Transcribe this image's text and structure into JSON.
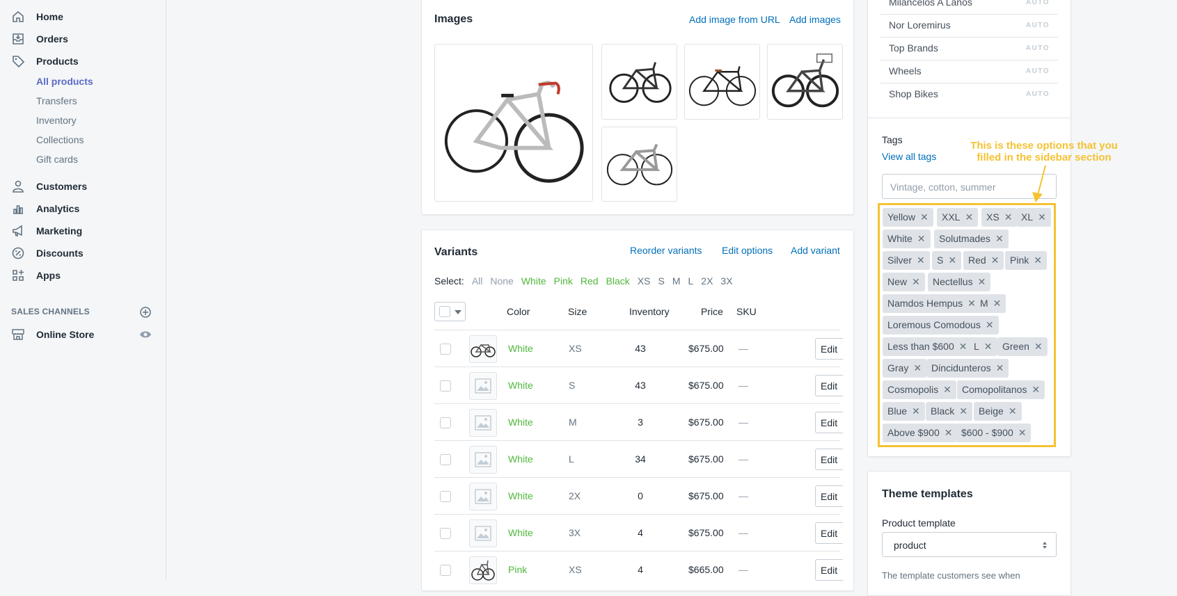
{
  "nav": {
    "home": "Home",
    "orders": "Orders",
    "products": "Products",
    "products_sub": [
      "All products",
      "Transfers",
      "Inventory",
      "Collections",
      "Gift cards"
    ],
    "customers": "Customers",
    "analytics": "Analytics",
    "marketing": "Marketing",
    "discounts": "Discounts",
    "apps": "Apps",
    "sales_channels": "SALES CHANNELS",
    "online_store": "Online Store"
  },
  "images": {
    "title": "Images",
    "add_from_url": "Add image from URL",
    "add_images": "Add images"
  },
  "variants": {
    "title": "Variants",
    "reorder": "Reorder variants",
    "edit_options": "Edit options",
    "add_variant": "Add variant",
    "select_label": "Select:",
    "select_opts": [
      "All",
      "None",
      "White",
      "Pink",
      "Red",
      "Black",
      "XS",
      "S",
      "M",
      "L",
      "2X",
      "3X"
    ],
    "headers": [
      "Color",
      "Size",
      "Inventory",
      "Price",
      "SKU"
    ],
    "edit_label": "Edit",
    "rows": [
      {
        "color": "White",
        "size": "XS",
        "inventory": "43",
        "price": "$675.00",
        "sku": "—"
      },
      {
        "color": "White",
        "size": "S",
        "inventory": "43",
        "price": "$675.00",
        "sku": "—"
      },
      {
        "color": "White",
        "size": "M",
        "inventory": "3",
        "price": "$675.00",
        "sku": "—"
      },
      {
        "color": "White",
        "size": "L",
        "inventory": "34",
        "price": "$675.00",
        "sku": "—"
      },
      {
        "color": "White",
        "size": "2X",
        "inventory": "0",
        "price": "$675.00",
        "sku": "—"
      },
      {
        "color": "White",
        "size": "3X",
        "inventory": "4",
        "price": "$675.00",
        "sku": "—"
      },
      {
        "color": "Pink",
        "size": "XS",
        "inventory": "4",
        "price": "$665.00",
        "sku": "—"
      }
    ]
  },
  "collections": {
    "auto_label": "AUTO",
    "items": [
      "Milancelos A Lanos",
      "Nor Loremirus",
      "Top Brands",
      "Wheels",
      "Shop Bikes"
    ]
  },
  "tags": {
    "title": "Tags",
    "view_all": "View all tags",
    "placeholder": "Vintage, cotton, summer",
    "items": [
      "Yellow",
      "XXL",
      "XS",
      "XL",
      "White",
      "Solutmades",
      "Silver",
      "S",
      "Red",
      "Pink",
      "New",
      "Nectellus",
      "Namdos Hempus",
      "M",
      "Loremous Comodous",
      "Less than $600",
      "L",
      "Green",
      "Gray",
      "Dincidunteros",
      "Cosmopolis",
      "Comopolitanos",
      "Blue",
      "Black",
      "Beige",
      "Above $900",
      "$600 - $900"
    ],
    "annotation_line1": "This is these options that you",
    "annotation_line2": "filled in the sidebar section"
  },
  "theme": {
    "title": "Theme templates",
    "product_template_label": "Product template",
    "product_template_value": "product",
    "helper": "The template customers see when"
  },
  "colors": {
    "accent": "#5c6ac4",
    "link": "#006fbb",
    "green": "#50b83c",
    "highlight": "#f5c232"
  }
}
